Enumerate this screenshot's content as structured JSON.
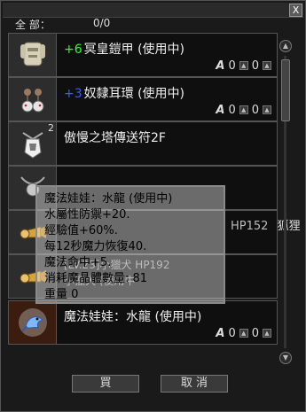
{
  "window": {
    "close_label": "X"
  },
  "header": {
    "total_label": "全 部：",
    "count": "0/0"
  },
  "items": [
    {
      "plus": "+6",
      "plus_color": "#2aff2a",
      "name": "冥皇鎧甲 (使用中)",
      "a": "A",
      "val1": "0",
      "val2": "0",
      "qty": "",
      "icon": "armor-icon"
    },
    {
      "plus": "+3",
      "plus_color": "#3a5bff",
      "name": "奴隸耳環 (使用中)",
      "a": "A",
      "val1": "0",
      "val2": "0",
      "qty": "",
      "icon": "earring-icon"
    },
    {
      "plus": "",
      "plus_color": "",
      "name": "傲慢之塔傳送符2F",
      "a": "",
      "val1": "",
      "val2": "",
      "qty": "2",
      "icon": "amulet-icon"
    },
    {
      "plus": "",
      "plus_color": "",
      "name": "",
      "a": "",
      "val1": "",
      "val2": "",
      "qty": "",
      "icon": "necklace-icon"
    },
    {
      "plus": "",
      "plus_color": "",
      "name": "",
      "a": "",
      "val1": "",
      "val2": "",
      "qty": "",
      "icon": "whistle-icon"
    },
    {
      "plus": "",
      "plus_color": "",
      "name": "",
      "a": "",
      "val1": "",
      "val2": "",
      "qty": "",
      "icon": "whistle-icon"
    },
    {
      "plus": "",
      "plus_color": "",
      "name": "魔法娃娃：水龍 (使用中)",
      "a": "A",
      "val1": "0",
      "val2": "0",
      "qty": "",
      "icon": "doll-icon"
    }
  ],
  "behind_texts": {
    "r4_right": "HP152",
    "r4_right2": "狐狸",
    "r5_mid": "[LV.23]小獵犬 HP192",
    "r5_bottom": "小獵犬 (使用中"
  },
  "tooltip": {
    "lines": [
      "魔法娃娃：水龍 (使用中)",
      "水屬性防禦+20.",
      "經驗值+60%.",
      "每12秒魔力恢復40.",
      "魔法命中+5.",
      "消耗魔晶體數量: 81",
      "重量 0"
    ]
  },
  "buttons": {
    "buy": "買",
    "cancel": "取 消"
  },
  "scrollbar": {
    "up": "▲",
    "down": "▼"
  }
}
